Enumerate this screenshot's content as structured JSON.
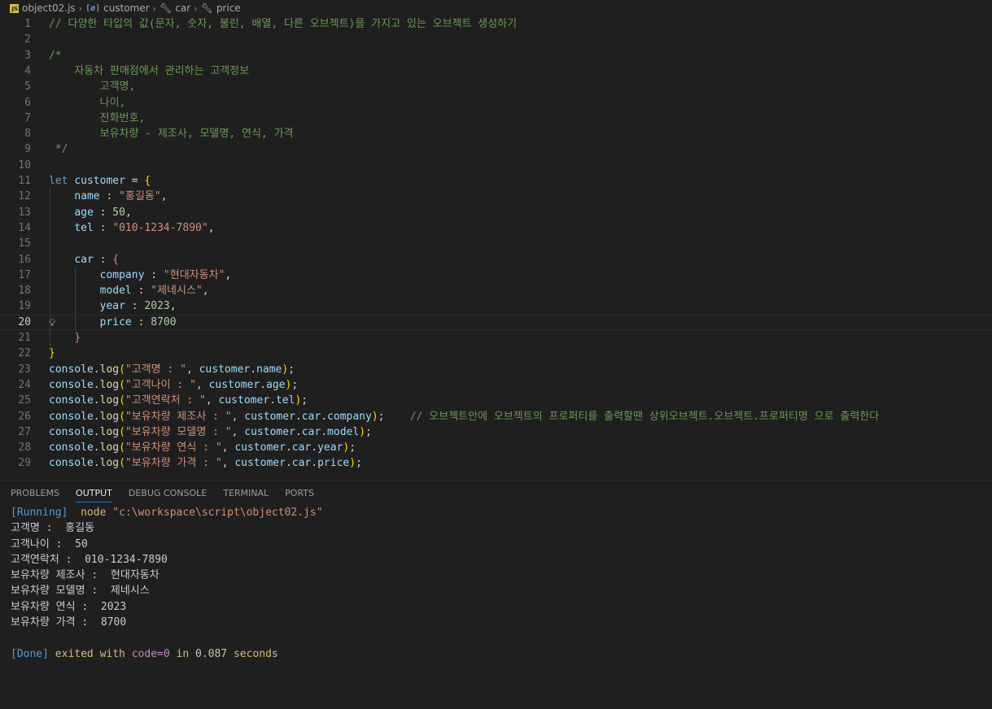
{
  "breadcrumb": {
    "file": "object02.js",
    "items": [
      "customer",
      "car",
      "price"
    ]
  },
  "editor": {
    "current_line": 20,
    "lines": [
      {
        "n": "1",
        "t": [
          [
            "c-com",
            "// 다양한 타입의 값(문자, 숫자, 불린, 배열, 다른 오브젝트)을 가지고 있는 오브젝트 생성하기"
          ]
        ]
      },
      {
        "n": "2",
        "t": []
      },
      {
        "n": "3",
        "t": [
          [
            "c-com",
            "/*"
          ]
        ]
      },
      {
        "n": "4",
        "t": [
          [
            "c-com",
            "    자동차 판매점에서 관리하는 고객정보"
          ]
        ]
      },
      {
        "n": "5",
        "t": [
          [
            "c-com",
            "        고객명,"
          ]
        ]
      },
      {
        "n": "6",
        "t": [
          [
            "c-com",
            "        나이,"
          ]
        ]
      },
      {
        "n": "7",
        "t": [
          [
            "c-com",
            "        전화번호,"
          ]
        ]
      },
      {
        "n": "8",
        "t": [
          [
            "c-com",
            "        보유차량 - 제조사, 모델명, 연식, 가격"
          ]
        ]
      },
      {
        "n": "9",
        "t": [
          [
            "c-com",
            " */"
          ]
        ]
      },
      {
        "n": "10",
        "t": []
      },
      {
        "n": "11",
        "t": [
          [
            "c-kw",
            "let"
          ],
          [
            "c-op",
            " "
          ],
          [
            "c-var",
            "customer"
          ],
          [
            "c-op",
            " = "
          ],
          [
            "c-b1",
            "{"
          ]
        ]
      },
      {
        "n": "12",
        "t": [
          [
            "c-op",
            "    "
          ],
          [
            "c-prop",
            "name"
          ],
          [
            "c-op",
            " : "
          ],
          [
            "c-str",
            "\"홍길동\""
          ],
          [
            "c-op",
            ","
          ]
        ]
      },
      {
        "n": "13",
        "t": [
          [
            "c-op",
            "    "
          ],
          [
            "c-prop",
            "age"
          ],
          [
            "c-op",
            " : "
          ],
          [
            "c-num",
            "50"
          ],
          [
            "c-op",
            ","
          ]
        ]
      },
      {
        "n": "14",
        "t": [
          [
            "c-op",
            "    "
          ],
          [
            "c-prop",
            "tel"
          ],
          [
            "c-op",
            " : "
          ],
          [
            "c-str",
            "\"010-1234-7890\""
          ],
          [
            "c-op",
            ","
          ]
        ]
      },
      {
        "n": "15",
        "t": []
      },
      {
        "n": "16",
        "t": [
          [
            "c-op",
            "    "
          ],
          [
            "c-prop",
            "car"
          ],
          [
            "c-op",
            " : "
          ],
          [
            "c-b2",
            "{"
          ]
        ]
      },
      {
        "n": "17",
        "t": [
          [
            "c-op",
            "        "
          ],
          [
            "c-prop",
            "company"
          ],
          [
            "c-op",
            " : "
          ],
          [
            "c-str",
            "\"현대자동차\""
          ],
          [
            "c-op",
            ","
          ]
        ]
      },
      {
        "n": "18",
        "t": [
          [
            "c-op",
            "        "
          ],
          [
            "c-prop",
            "model"
          ],
          [
            "c-op",
            " : "
          ],
          [
            "c-str",
            "\"제네시스\""
          ],
          [
            "c-op",
            ","
          ]
        ]
      },
      {
        "n": "19",
        "t": [
          [
            "c-op",
            "        "
          ],
          [
            "c-prop",
            "year"
          ],
          [
            "c-op",
            " : "
          ],
          [
            "c-num",
            "2023"
          ],
          [
            "c-op",
            ","
          ]
        ]
      },
      {
        "n": "20",
        "t": [
          [
            "c-op",
            "        "
          ],
          [
            "c-prop",
            "price"
          ],
          [
            "c-op",
            " : "
          ],
          [
            "c-num",
            "8700"
          ]
        ]
      },
      {
        "n": "21",
        "t": [
          [
            "c-op",
            "    "
          ],
          [
            "c-b2",
            "}"
          ]
        ]
      },
      {
        "n": "22",
        "t": [
          [
            "c-b1",
            "}"
          ]
        ]
      },
      {
        "n": "23",
        "t": [
          [
            "c-var",
            "console"
          ],
          [
            "c-op",
            "."
          ],
          [
            "c-fn",
            "log"
          ],
          [
            "c-b1",
            "("
          ],
          [
            "c-str",
            "\"고객명 : \""
          ],
          [
            "c-op",
            ", "
          ],
          [
            "c-var",
            "customer"
          ],
          [
            "c-op",
            "."
          ],
          [
            "c-prop",
            "name"
          ],
          [
            "c-b1",
            ")"
          ],
          [
            "c-op",
            ";"
          ]
        ]
      },
      {
        "n": "24",
        "t": [
          [
            "c-var",
            "console"
          ],
          [
            "c-op",
            "."
          ],
          [
            "c-fn",
            "log"
          ],
          [
            "c-b1",
            "("
          ],
          [
            "c-str",
            "\"고객나이 : \""
          ],
          [
            "c-op",
            ", "
          ],
          [
            "c-var",
            "customer"
          ],
          [
            "c-op",
            "."
          ],
          [
            "c-prop",
            "age"
          ],
          [
            "c-b1",
            ")"
          ],
          [
            "c-op",
            ";"
          ]
        ]
      },
      {
        "n": "25",
        "t": [
          [
            "c-var",
            "console"
          ],
          [
            "c-op",
            "."
          ],
          [
            "c-fn",
            "log"
          ],
          [
            "c-b1",
            "("
          ],
          [
            "c-str",
            "\"고객연락처 : \""
          ],
          [
            "c-op",
            ", "
          ],
          [
            "c-var",
            "customer"
          ],
          [
            "c-op",
            "."
          ],
          [
            "c-prop",
            "tel"
          ],
          [
            "c-b1",
            ")"
          ],
          [
            "c-op",
            ";"
          ]
        ]
      },
      {
        "n": "26",
        "t": [
          [
            "c-var",
            "console"
          ],
          [
            "c-op",
            "."
          ],
          [
            "c-fn",
            "log"
          ],
          [
            "c-b1",
            "("
          ],
          [
            "c-str",
            "\"보유차량 제조사 : \""
          ],
          [
            "c-op",
            ", "
          ],
          [
            "c-var",
            "customer"
          ],
          [
            "c-op",
            "."
          ],
          [
            "c-prop",
            "car"
          ],
          [
            "c-op",
            "."
          ],
          [
            "c-prop",
            "company"
          ],
          [
            "c-b1",
            ")"
          ],
          [
            "c-op",
            ";    "
          ],
          [
            "c-com",
            "// 오브젝트안에 오브젝트의 프로퍼티를 출력할땐 상위오브젝트.오브젝트.프로퍼티명 으로 출력한다"
          ]
        ]
      },
      {
        "n": "27",
        "t": [
          [
            "c-var",
            "console"
          ],
          [
            "c-op",
            "."
          ],
          [
            "c-fn",
            "log"
          ],
          [
            "c-b1",
            "("
          ],
          [
            "c-str",
            "\"보유차량 모델명 : \""
          ],
          [
            "c-op",
            ", "
          ],
          [
            "c-var",
            "customer"
          ],
          [
            "c-op",
            "."
          ],
          [
            "c-prop",
            "car"
          ],
          [
            "c-op",
            "."
          ],
          [
            "c-prop",
            "model"
          ],
          [
            "c-b1",
            ")"
          ],
          [
            "c-op",
            ";"
          ]
        ]
      },
      {
        "n": "28",
        "t": [
          [
            "c-var",
            "console"
          ],
          [
            "c-op",
            "."
          ],
          [
            "c-fn",
            "log"
          ],
          [
            "c-b1",
            "("
          ],
          [
            "c-str",
            "\"보유차량 연식 : \""
          ],
          [
            "c-op",
            ", "
          ],
          [
            "c-var",
            "customer"
          ],
          [
            "c-op",
            "."
          ],
          [
            "c-prop",
            "car"
          ],
          [
            "c-op",
            "."
          ],
          [
            "c-prop",
            "year"
          ],
          [
            "c-b1",
            ")"
          ],
          [
            "c-op",
            ";"
          ]
        ]
      },
      {
        "n": "29",
        "t": [
          [
            "c-var",
            "console"
          ],
          [
            "c-op",
            "."
          ],
          [
            "c-fn",
            "log"
          ],
          [
            "c-b1",
            "("
          ],
          [
            "c-str",
            "\"보유차량 가격 : \""
          ],
          [
            "c-op",
            ", "
          ],
          [
            "c-var",
            "customer"
          ],
          [
            "c-op",
            "."
          ],
          [
            "c-prop",
            "car"
          ],
          [
            "c-op",
            "."
          ],
          [
            "c-prop",
            "price"
          ],
          [
            "c-b1",
            ")"
          ],
          [
            "c-op",
            ";"
          ]
        ]
      }
    ]
  },
  "panel": {
    "tabs": [
      "PROBLEMS",
      "OUTPUT",
      "DEBUG CONSOLE",
      "TERMINAL",
      "PORTS"
    ],
    "active_tab": "OUTPUT",
    "output": [
      [
        [
          "o-blue",
          "[Running]"
        ],
        [
          "",
          "  "
        ],
        [
          "o-yellow",
          "node"
        ],
        [
          "",
          ""
        ],
        [
          "o-str",
          " \"c:\\workspace\\script\\object02.js\""
        ]
      ],
      [
        [
          "",
          "고객명 :  홍길동"
        ]
      ],
      [
        [
          "",
          "고객나이 :  50"
        ]
      ],
      [
        [
          "",
          "고객연락처 :  010-1234-7890"
        ]
      ],
      [
        [
          "",
          "보유차량 제조사 :  현대자동차"
        ]
      ],
      [
        [
          "",
          "보유차량 모델명 :  제네시스"
        ]
      ],
      [
        [
          "",
          "보유차량 연식 :  2023"
        ]
      ],
      [
        [
          "",
          "보유차량 가격 :  8700"
        ]
      ],
      [
        [
          "",
          ""
        ]
      ],
      [
        [
          "o-blue",
          "[Done]"
        ],
        [
          "o-yellow",
          " exited with "
        ],
        [
          "o-purple",
          "code=0"
        ],
        [
          "o-yellow",
          " in "
        ],
        [
          "o-green",
          "0.087"
        ],
        [
          "o-yellow",
          " seconds"
        ]
      ]
    ]
  }
}
